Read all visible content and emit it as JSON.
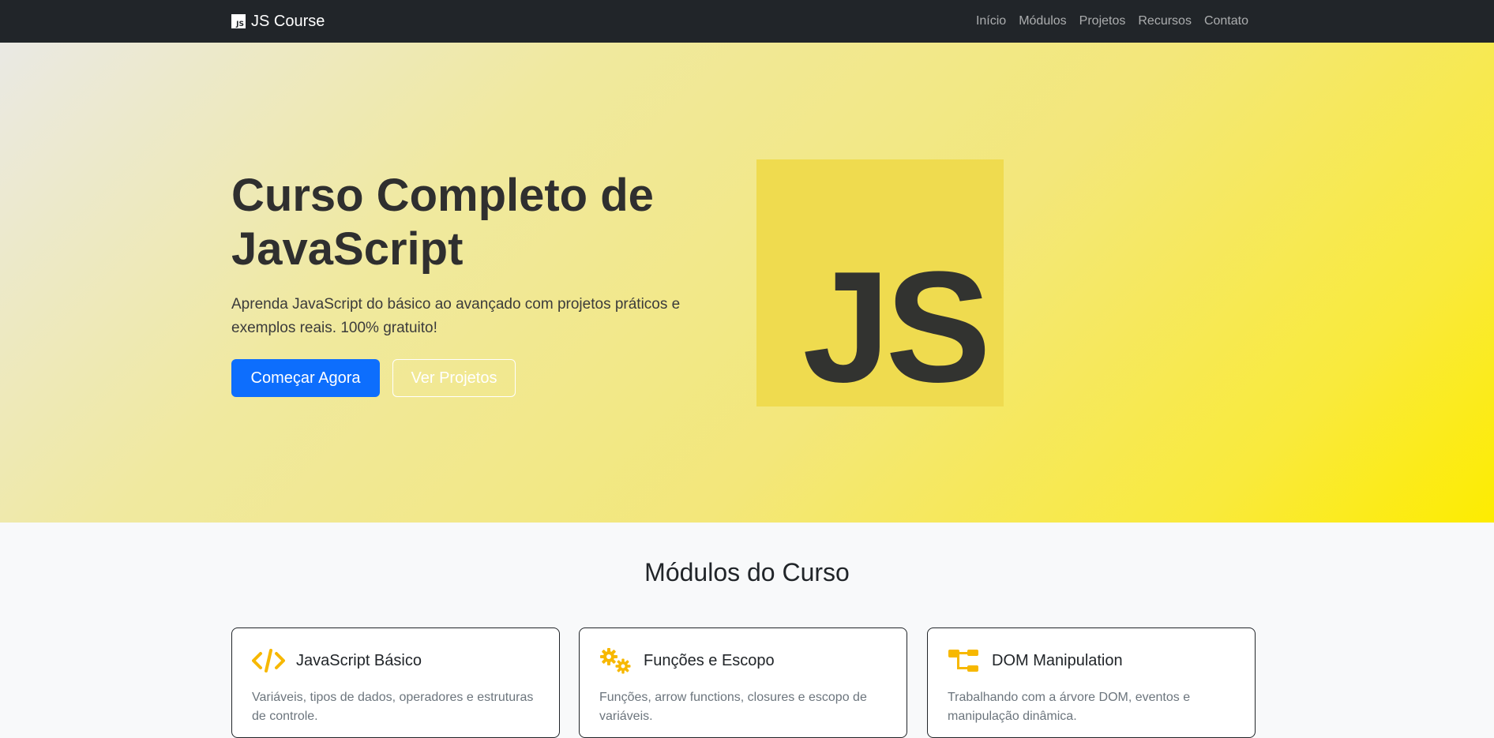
{
  "navbar": {
    "brand_logo_text": "JS",
    "brand": "JS Course",
    "links": [
      "Início",
      "Módulos",
      "Projetos",
      "Recursos",
      "Contato"
    ]
  },
  "hero": {
    "title": "Curso Completo de JavaScript",
    "subtitle": "Aprenda JavaScript do básico ao avançado com projetos práticos e exemplos reais. 100% gratuito!",
    "primary_button": "Começar Agora",
    "secondary_button": "Ver Projetos",
    "logo_text": "JS"
  },
  "modules": {
    "title": "Módulos do Curso",
    "cards": [
      {
        "icon": "code-icon",
        "title": "JavaScript Básico",
        "text": "Variáveis, tipos de dados, operadores e estruturas de controle."
      },
      {
        "icon": "gears-icon",
        "title": "Funções e Escopo",
        "text": "Funções, arrow functions, closures e escopo de variáveis."
      },
      {
        "icon": "sitemap-icon",
        "title": "DOM Manipulation",
        "text": "Trabalhando com a árvore DOM, eventos e manipulação dinâmica."
      }
    ]
  },
  "colors": {
    "navbar": "#212529",
    "primary": "#0d6efd",
    "js_yellow": "#efdb4f",
    "icon_accent": "#f7b800"
  }
}
